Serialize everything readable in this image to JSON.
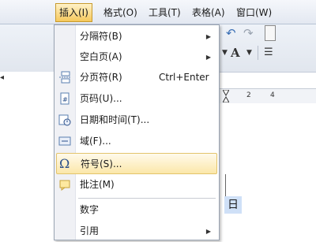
{
  "menubar": {
    "items": [
      {
        "label": "插入(I)",
        "active": true
      },
      {
        "label": "格式(O)"
      },
      {
        "label": "工具(T)"
      },
      {
        "label": "表格(A)"
      },
      {
        "label": "窗口(W)"
      }
    ]
  },
  "toolbar": {
    "font_glyph": "A",
    "ruler_numbers": [
      "2",
      "4"
    ]
  },
  "document": {
    "selected_char": "日"
  },
  "insert_menu": {
    "items": [
      {
        "label": "分隔符(B)",
        "submenu": true
      },
      {
        "label": "空白页(A)",
        "submenu": true
      },
      {
        "label": "分页符(R)",
        "shortcut": "Ctrl+Enter",
        "icon": "page-break-icon"
      },
      {
        "label": "页码(U)...",
        "icon": "page-number-icon"
      },
      {
        "label": "日期和时间(T)...",
        "icon": "date-time-icon"
      },
      {
        "label": "域(F)...",
        "icon": "field-icon"
      },
      {
        "label": "符号(S)...",
        "icon": "omega-symbol-icon",
        "highlighted": true
      },
      {
        "label": "批注(M)",
        "icon": "comment-icon"
      },
      {
        "label": "数字"
      },
      {
        "label": "引用",
        "submenu": true
      }
    ]
  },
  "colors": {
    "menu_highlight": "#fbe7a9",
    "menubar_active": "#f6c85c",
    "selection": "#cfe0f7"
  }
}
